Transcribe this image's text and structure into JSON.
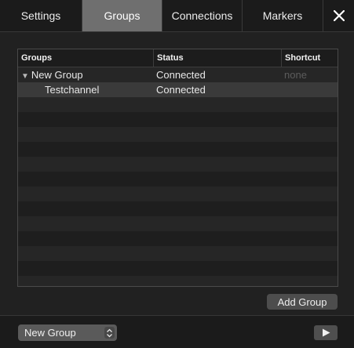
{
  "tabs": [
    {
      "label": "Settings",
      "active": false
    },
    {
      "label": "Groups",
      "active": true
    },
    {
      "label": "Connections",
      "active": false
    },
    {
      "label": "Markers",
      "active": false
    }
  ],
  "close_icon": "close-icon",
  "table": {
    "headers": [
      "Groups",
      "Status",
      "Shortcut"
    ],
    "rows": [
      {
        "name": "New Group",
        "status": "Connected",
        "shortcut": "none",
        "expanded": true,
        "expander_icon": "triangle-down-icon"
      },
      {
        "name": "Testchannel",
        "status": "Connected",
        "shortcut": "",
        "selected": true
      }
    ],
    "empty_rows": 13
  },
  "add_group_label": "Add Group",
  "bottom": {
    "group_select_value": "New Group",
    "stepper_icon": "up-down-stepper-icon",
    "play_icon": "play-icon"
  }
}
